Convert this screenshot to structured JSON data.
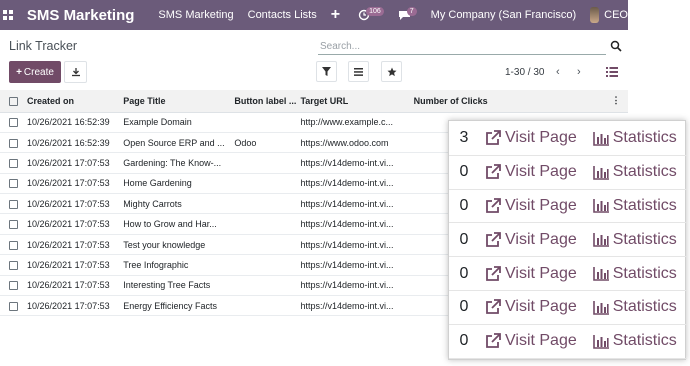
{
  "topbar": {
    "brand": "SMS Marketing",
    "menus": [
      "SMS Marketing",
      "Contacts Lists"
    ],
    "plus": "+",
    "activity_count": "106",
    "message_count": "7",
    "company": "My Company (San Francisco)",
    "user": "CEO"
  },
  "control": {
    "title": "Link Tracker",
    "search_placeholder": "Search...",
    "create_label": "Create",
    "pager": "1-30 / 30",
    "prev": "‹",
    "next": "›"
  },
  "table": {
    "headers": [
      "Created on",
      "Page Title",
      "Button label ...",
      "Target URL",
      "Number of Clicks"
    ],
    "rows": [
      [
        "10/26/2021 16:52:39",
        "Example Domain",
        "",
        "http://www.example.c...",
        ""
      ],
      [
        "10/26/2021 16:52:39",
        "Open Source ERP and ...",
        "Odoo",
        "https://www.odoo.com",
        ""
      ],
      [
        "10/26/2021 17:07:53",
        "Gardening: The Know-...",
        "",
        "https://v14demo-int.vi...",
        ""
      ],
      [
        "10/26/2021 17:07:53",
        "Home Gardening",
        "",
        "https://v14demo-int.vi...",
        ""
      ],
      [
        "10/26/2021 17:07:53",
        "Mighty Carrots",
        "",
        "https://v14demo-int.vi...",
        ""
      ],
      [
        "10/26/2021 17:07:53",
        "How to Grow and Har...",
        "",
        "https://v14demo-int.vi...",
        ""
      ],
      [
        "10/26/2021 17:07:53",
        "Test your knowledge",
        "",
        "https://v14demo-int.vi...",
        ""
      ],
      [
        "10/26/2021 17:07:53",
        "Tree Infographic",
        "",
        "https://v14demo-int.vi...",
        ""
      ],
      [
        "10/26/2021 17:07:53",
        "Interesting Tree Facts",
        "",
        "https://v14demo-int.vi...",
        ""
      ],
      [
        "10/26/2021 17:07:53",
        "Energy Efficiency Facts",
        "",
        "https://v14demo-int.vi...",
        ""
      ]
    ]
  },
  "overlay": {
    "visit_label": "Visit Page",
    "stats_label": "Statistics",
    "clicks": [
      "3",
      "0",
      "0",
      "0",
      "0",
      "0",
      "0"
    ]
  },
  "colors": {
    "topbar": "#6b5b7a",
    "primary": "#714b67"
  }
}
